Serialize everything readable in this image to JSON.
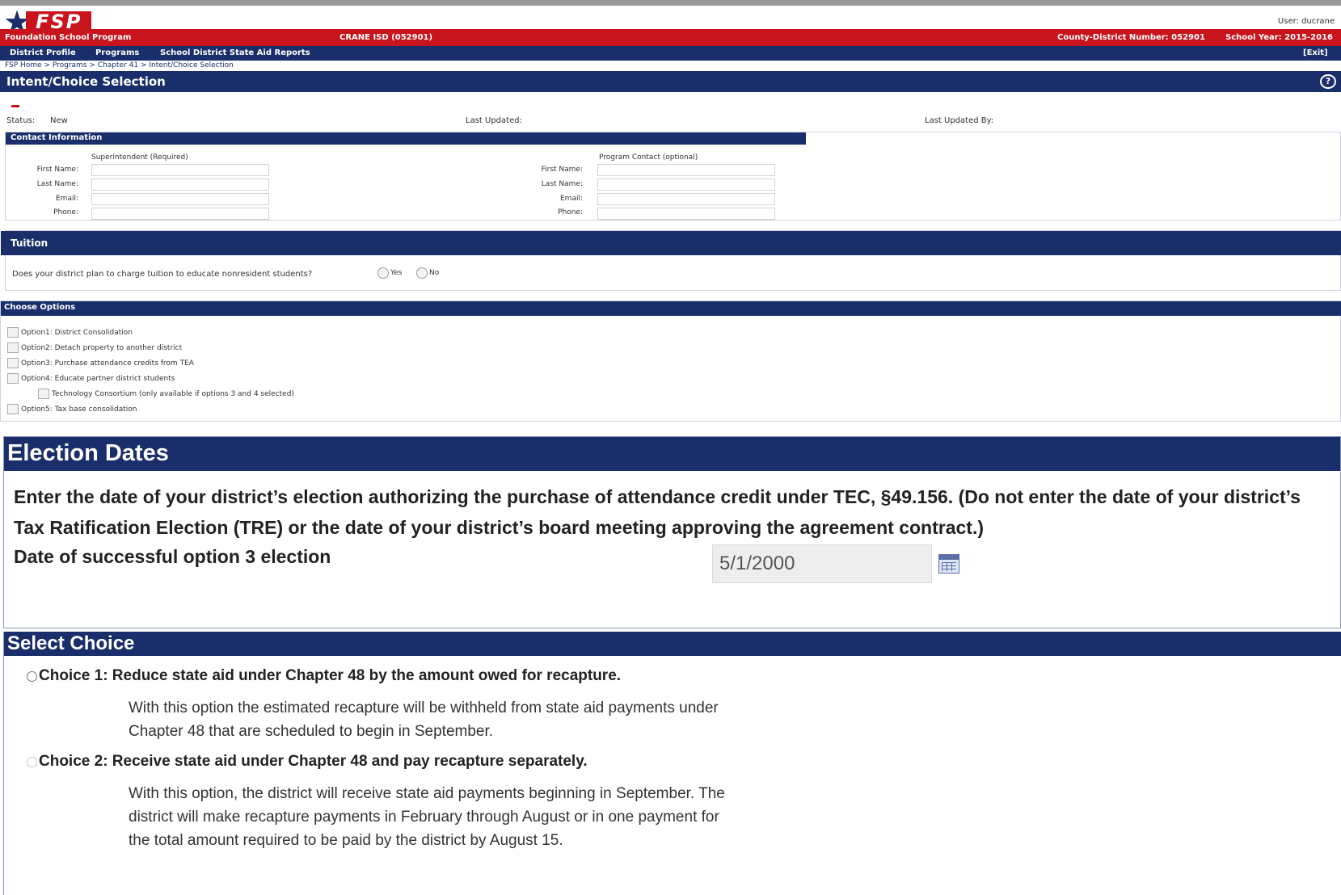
{
  "header": {
    "logo_text": "FSP",
    "user": "User: ducrane",
    "program": "Foundation School Program",
    "district": "CRANE ISD (052901)",
    "county_district": "County-District Number: 052901",
    "school_year": "School Year: 2015-2016"
  },
  "nav": {
    "items": [
      "District Profile",
      "Programs",
      "School District State Aid Reports"
    ],
    "exit": "[Exit]"
  },
  "breadcrumb": "FSP Home > Programs > Chapter 41 > Intent/Choice Selection",
  "page_title": "Intent/Choice Selection",
  "help_icon": "?",
  "status": {
    "status_label": "Status:",
    "status_value": "New",
    "last_updated_label": "Last Updated:",
    "last_updated_by_label": "Last Updated By:"
  },
  "contact": {
    "title": "Contact Information",
    "superintendent_head": "Superintendent (Required)",
    "program_contact_head": "Program Contact (optional)",
    "labels": [
      "First Name:",
      "Last Name:",
      "Email:",
      "Phone:"
    ]
  },
  "tuition": {
    "title": "Tuition",
    "question": "Does your district plan to charge tuition to educate nonresident students?",
    "yes": "Yes",
    "no": "No"
  },
  "options": {
    "title": "Choose Options",
    "items": [
      "Option1: District Consolidation",
      "Option2: Detach property to another district",
      "Option3: Purchase attendance credits from TEA",
      "Option4: Educate partner district students",
      "Technology Consortium (only available if options 3 and 4 selected)",
      "Option5: Tax base consolidation"
    ]
  },
  "election": {
    "title": "Election Dates",
    "instructions": "Enter the date of your district’s election authorizing the purchase of attendance credit under TEC, §49.156. (Do not enter the date of your district’s Tax Ratification Election (TRE) or the date of your district’s board meeting approving the agreement contract.)",
    "date_label": "Date of successful option 3 election",
    "date_value": "5/1/2000"
  },
  "choice": {
    "title": "Select Choice",
    "choice1_title": "Choice 1: Reduce state aid under Chapter 48 by the amount owed for recapture.",
    "choice1_desc": "With this option the estimated recapture will be withheld from state aid payments under Chapter 48 that are scheduled to begin in September.",
    "choice2_title": "Choice 2: Receive state aid under Chapter 48 and pay recapture separately.",
    "choice2_desc": "With this option, the district will receive state aid payments beginning in September. The district will make recapture payments in February through August or in one payment for the total amount required to be paid by the district by August 15."
  }
}
